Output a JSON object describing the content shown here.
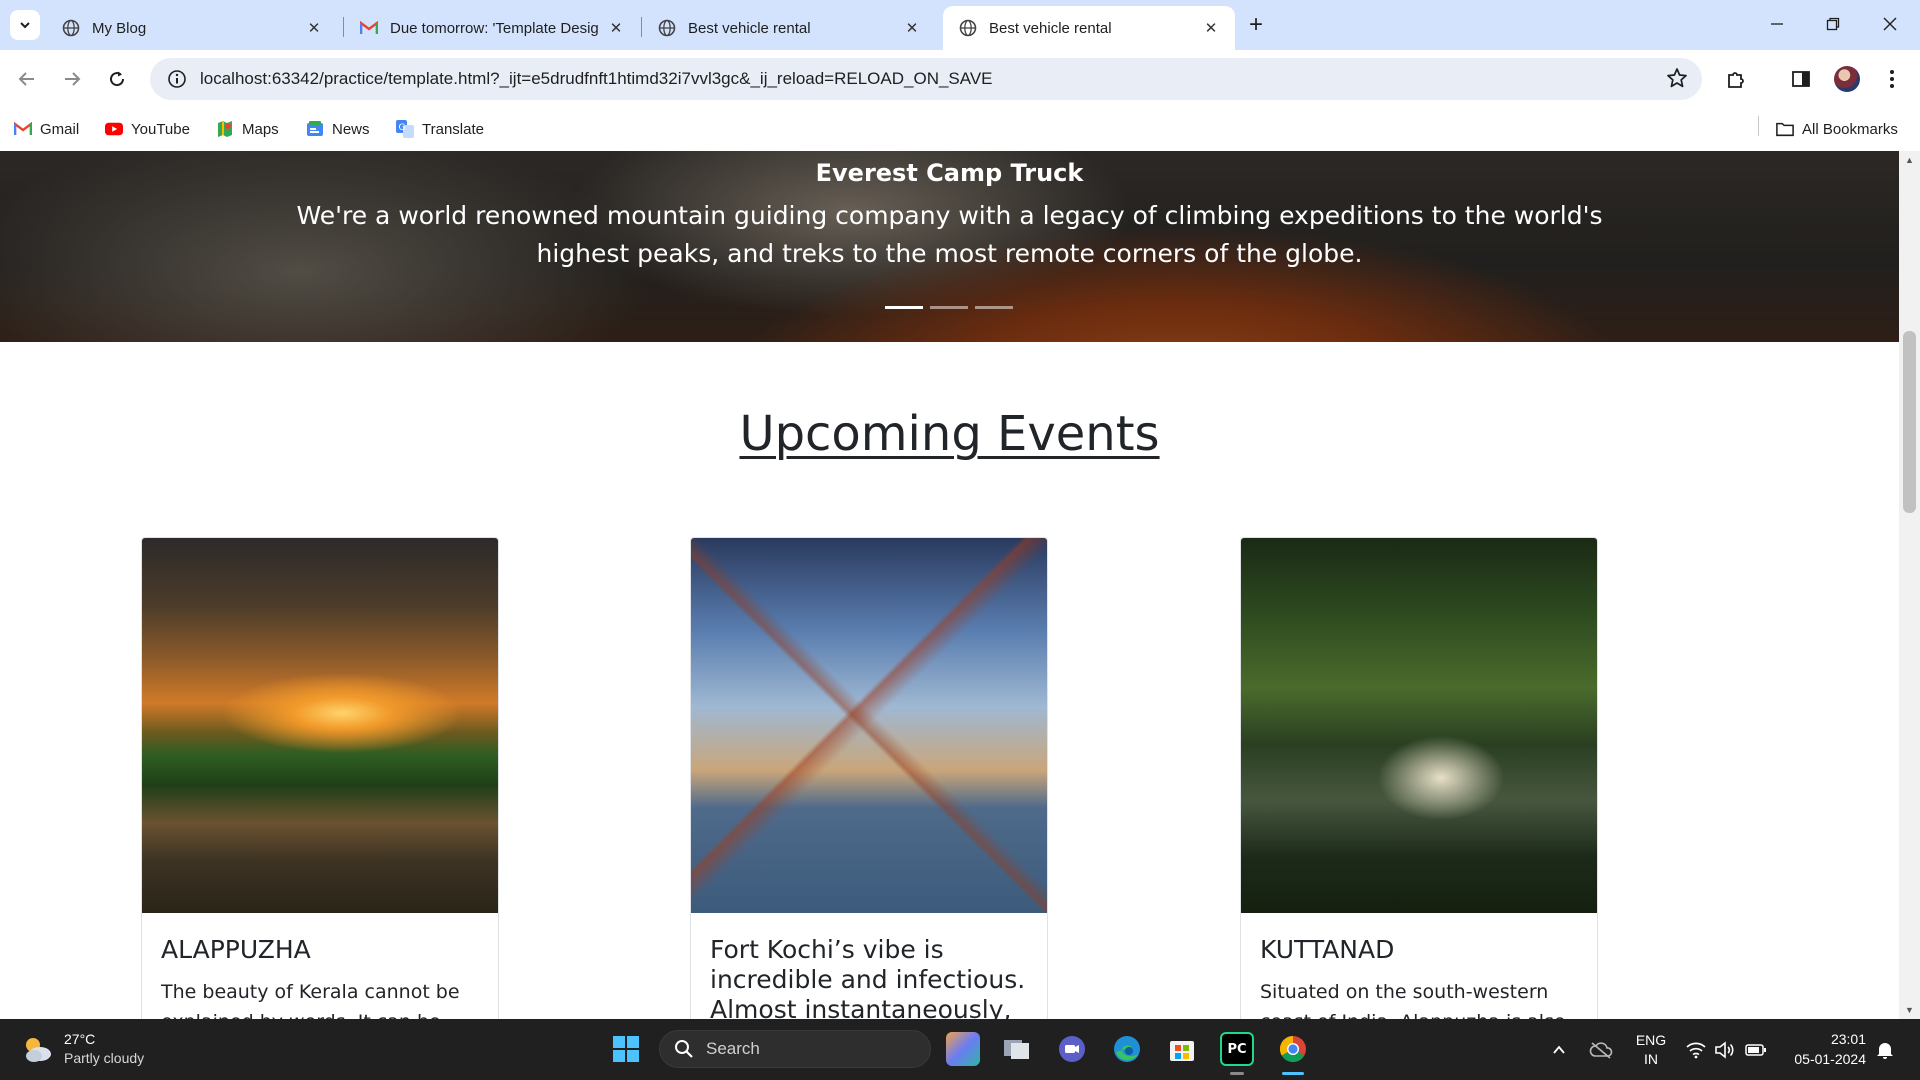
{
  "browser": {
    "tabs": [
      {
        "title": "My Blog",
        "icon": "globe-icon",
        "active": false
      },
      {
        "title": "Due tomorrow: 'Template Desig",
        "icon": "gmail-icon",
        "active": false
      },
      {
        "title": "Best vehicle rental",
        "icon": "globe-icon",
        "active": false
      },
      {
        "title": "Best vehicle rental",
        "icon": "globe-icon",
        "active": true
      }
    ],
    "url": "localhost:63342/practice/template.html?_ijt=e5drudfnft1htimd32i7vvl3gc&_ij_reload=RELOAD_ON_SAVE",
    "bookmarks": [
      {
        "label": "Gmail",
        "icon": "gmail-icon"
      },
      {
        "label": "YouTube",
        "icon": "youtube-icon"
      },
      {
        "label": "Maps",
        "icon": "maps-icon"
      },
      {
        "label": "News",
        "icon": "news-icon"
      },
      {
        "label": "Translate",
        "icon": "translate-icon"
      }
    ],
    "all_bookmarks": "All Bookmarks"
  },
  "page": {
    "hero": {
      "title": "Everest Camp Truck",
      "text": "We're a world renowned mountain guiding company with a legacy of climbing expeditions to the world's highest peaks, and treks to the most remote corners of the globe.",
      "active_slide": 1,
      "slides": 3
    },
    "events_heading": "Upcoming Events",
    "cards": [
      {
        "title": "ALAPPUZHA",
        "text": "The beauty of Kerala cannot be explained by words. It can be"
      },
      {
        "title": "Fort Kochi’s vibe is incredible and infectious. Almost instantaneously,",
        "text": ""
      },
      {
        "title": "KUTTANAD",
        "text": "Situated on the south-western coast of India, Alappuzha is also"
      }
    ]
  },
  "taskbar": {
    "weather_temp": "27°C",
    "weather_desc": "Partly cloudy",
    "search_label": "Search",
    "lang_1": "ENG",
    "lang_2": "IN",
    "time": "23:01",
    "date": "05-01-2024"
  },
  "colors": {
    "tabstrip": "#d3e3fd",
    "taskbar": "#202020",
    "accent": "#0b57d0"
  }
}
